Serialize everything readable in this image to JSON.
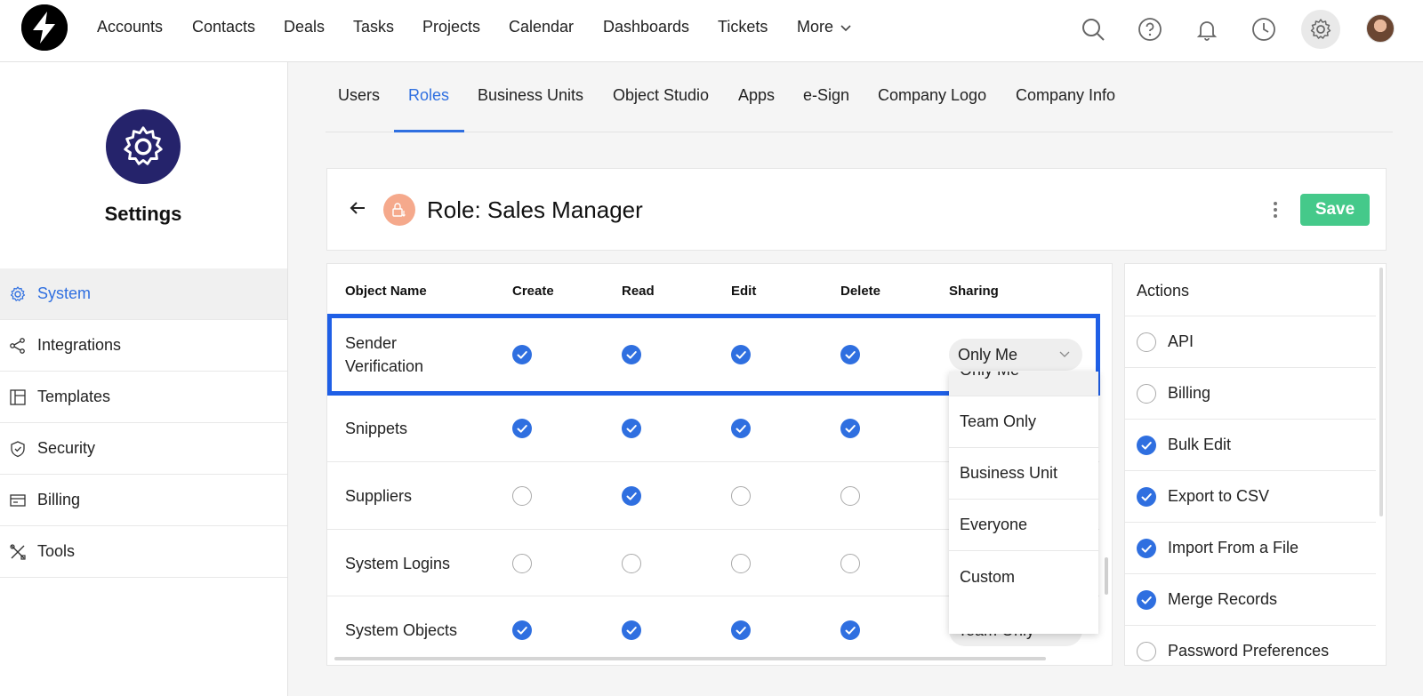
{
  "nav": {
    "items": [
      "Accounts",
      "Contacts",
      "Deals",
      "Tasks",
      "Projects",
      "Calendar",
      "Dashboards",
      "Tickets",
      "More"
    ],
    "icons": [
      "search-icon",
      "help-icon",
      "bell-icon",
      "clock-icon",
      "gear-icon"
    ]
  },
  "sidebar": {
    "title": "Settings",
    "items": [
      {
        "label": "System",
        "icon": "gear-icon",
        "active": true
      },
      {
        "label": "Integrations",
        "icon": "share-icon"
      },
      {
        "label": "Templates",
        "icon": "template-icon"
      },
      {
        "label": "Security",
        "icon": "shield-icon"
      },
      {
        "label": "Billing",
        "icon": "card-icon"
      },
      {
        "label": "Tools",
        "icon": "tools-icon"
      }
    ]
  },
  "tabs": [
    "Users",
    "Roles",
    "Business Units",
    "Object Studio",
    "Apps",
    "e-Sign",
    "Company Logo",
    "Company Info"
  ],
  "active_tab": "Roles",
  "header": {
    "title": "Role: Sales Manager",
    "save_label": "Save"
  },
  "permissions": {
    "columns": [
      "Object Name",
      "Create",
      "Read",
      "Edit",
      "Delete",
      "Sharing"
    ],
    "rows": [
      {
        "name": "Sender Verification",
        "create": true,
        "read": true,
        "edit": true,
        "delete": true,
        "sharing": "Only Me"
      },
      {
        "name": "Snippets",
        "create": true,
        "read": true,
        "edit": true,
        "delete": true,
        "sharing": ""
      },
      {
        "name": "Suppliers",
        "create": false,
        "read": true,
        "edit": false,
        "delete": false,
        "sharing": ""
      },
      {
        "name": "System Logins",
        "create": false,
        "read": false,
        "edit": false,
        "delete": false,
        "sharing": ""
      },
      {
        "name": "System Objects",
        "create": true,
        "read": true,
        "edit": true,
        "delete": true,
        "sharing": "Team Only"
      }
    ]
  },
  "sharing_dropdown": {
    "options": [
      "Only Me",
      "Team Only",
      "Business Unit",
      "Everyone",
      "Custom"
    ],
    "selected": "Only Me"
  },
  "actions": {
    "title": "Actions",
    "items": [
      {
        "label": "API",
        "checked": false
      },
      {
        "label": "Billing",
        "checked": false
      },
      {
        "label": "Bulk Edit",
        "checked": true
      },
      {
        "label": "Export to CSV",
        "checked": true
      },
      {
        "label": "Import From a File",
        "checked": true
      },
      {
        "label": "Merge Records",
        "checked": true
      },
      {
        "label": "Password Preferences",
        "checked": false
      }
    ]
  },
  "colors": {
    "accent": "#2f6fe0",
    "save": "#45c98a",
    "highlight": "#1f5fe6",
    "settings_badge": "#25236b",
    "role_icon": "#f5a98c"
  }
}
